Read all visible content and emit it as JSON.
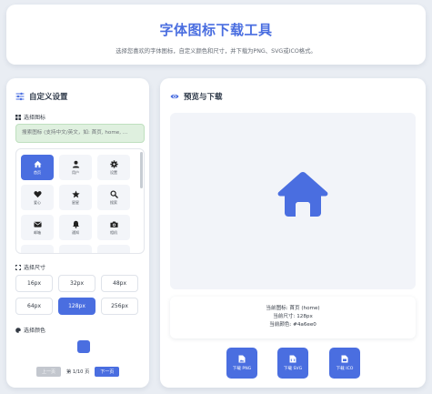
{
  "header": {
    "title": "字体图标下载工具",
    "subtitle": "选择您喜欢的字体图标，自定义颜色和尺寸，并下载为PNG、SVG或ICO格式。"
  },
  "settings": {
    "title": "自定义设置",
    "select_icon_label": "选择图标",
    "search_placeholder": "搜索图标 (支持中文/英文，如: 首页, home, …",
    "icons": [
      {
        "label": "首页",
        "icon": "home-icon",
        "selected": true
      },
      {
        "label": "用户",
        "icon": "user-icon",
        "selected": false
      },
      {
        "label": "设置",
        "icon": "gear-icon",
        "selected": false
      },
      {
        "label": "爱心",
        "icon": "heart-icon",
        "selected": false
      },
      {
        "label": "星星",
        "icon": "star-icon",
        "selected": false
      },
      {
        "label": "搜索",
        "icon": "search-icon",
        "selected": false
      },
      {
        "label": "邮箱",
        "icon": "envelope-icon",
        "selected": false
      },
      {
        "label": "通知",
        "icon": "bell-icon",
        "selected": false
      },
      {
        "label": "相机",
        "icon": "camera-icon",
        "selected": false
      },
      {
        "label": "",
        "icon": "music-icon",
        "selected": false
      },
      {
        "label": "",
        "icon": "film-icon",
        "selected": false
      },
      {
        "label": "",
        "icon": "globe-icon",
        "selected": false
      }
    ],
    "select_size_label": "选择尺寸",
    "sizes": [
      {
        "label": "16px",
        "selected": false
      },
      {
        "label": "32px",
        "selected": false
      },
      {
        "label": "48px",
        "selected": false
      },
      {
        "label": "64px",
        "selected": false
      },
      {
        "label": "128px",
        "selected": true
      },
      {
        "label": "256px",
        "selected": false
      }
    ],
    "select_color_label": "选择颜色",
    "color": "#4a6ee0",
    "pager": {
      "prev": "上一页",
      "info": "第 1/10 页",
      "next": "下一页"
    }
  },
  "preview": {
    "title": "预览与下载",
    "current_icon": "当前图标: 首页 (home)",
    "current_size": "当前尺寸: 128px",
    "current_color": "当前颜色: #4a6ee0",
    "downloads": [
      "下载 PNG",
      "下载 SVG",
      "下载 ICO"
    ]
  },
  "colors": {
    "accent": "#4a6ee0",
    "search_bg": "#dff0df"
  }
}
